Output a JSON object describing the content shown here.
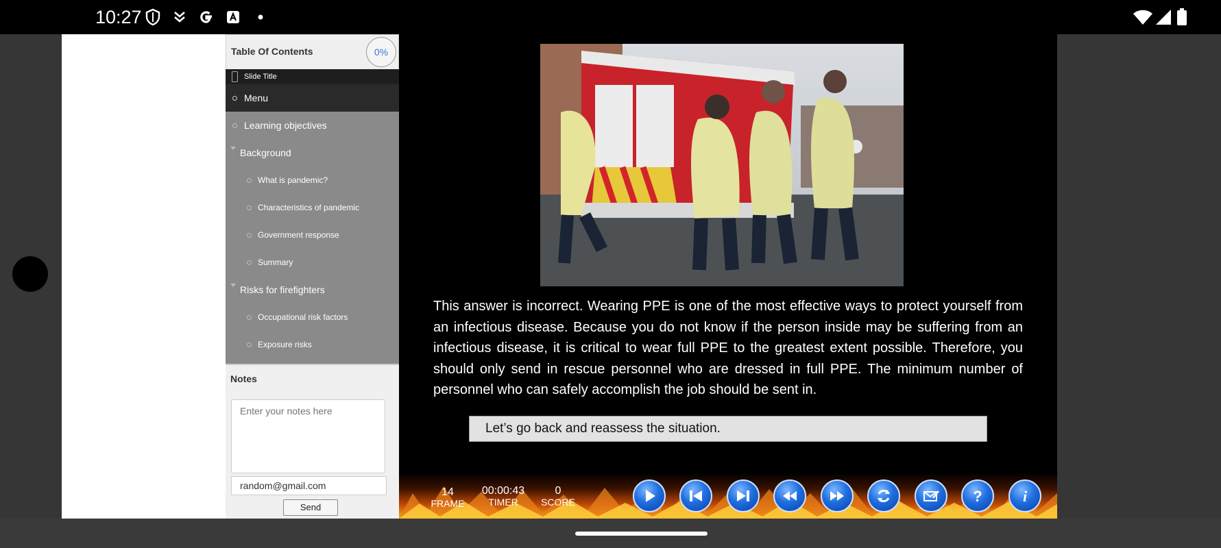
{
  "status_bar": {
    "time": "10:27",
    "left_icons": [
      "shield-icon",
      "activity-icon",
      "google-icon",
      "font-icon",
      "dot-icon"
    ],
    "right_icons": [
      "wifi-icon",
      "signal-icon",
      "battery-icon"
    ]
  },
  "sidebar": {
    "toc_title": "Table Of Contents",
    "progress": "0%",
    "slide_title": "Slide Title",
    "menu": "Menu",
    "items": [
      {
        "label": "Learning objectives",
        "level": 1,
        "expandable": false
      },
      {
        "label": "Background",
        "level": 1,
        "expandable": true
      },
      {
        "label": "What is pandemic?",
        "level": 2
      },
      {
        "label": "Characteristics of pandemic",
        "level": 2
      },
      {
        "label": "Government response",
        "level": 2
      },
      {
        "label": "Summary",
        "level": 2
      },
      {
        "label": "Risks for firefighters",
        "level": 1,
        "expandable": true
      },
      {
        "label": "Occupational risk factors",
        "level": 2
      },
      {
        "label": "Exposure risks",
        "level": 2
      }
    ],
    "notes": {
      "label": "Notes",
      "placeholder": "Enter your notes here",
      "email": "random@gmail.com",
      "send_label": "Send"
    }
  },
  "slide": {
    "feedback_text": "This answer is incorrect. Wearing PPE is one of the most effective ways to protect yourself from an infectious disease. Because you do not know if the person inside may be suffering from an infectious disease, it is critical to wear full PPE to the greatest extent possible. Therefore, you should only send in rescue personnel who are dressed in full PPE. The minimum number of personnel who can safely accomplish the job should be sent in.",
    "reassess_label": "Let’s go back and reassess the situation."
  },
  "controls": {
    "frame_value": "14",
    "frame_label": "FRAME",
    "timer_value": "00:00:43",
    "timer_label": "TIMER",
    "score_value": "0",
    "score_label": "SCORE",
    "buttons": [
      "play-icon",
      "first-slide-icon",
      "last-slide-icon",
      "rewind-icon",
      "fast-forward-icon",
      "refresh-icon",
      "email-icon",
      "help-icon",
      "info-icon"
    ]
  },
  "colors": {
    "accent_blue": "#1f6fe0",
    "progress_text": "#3a78d6",
    "sidebar_bg": "#8a8a8a",
    "slide_bg": "#000000"
  }
}
